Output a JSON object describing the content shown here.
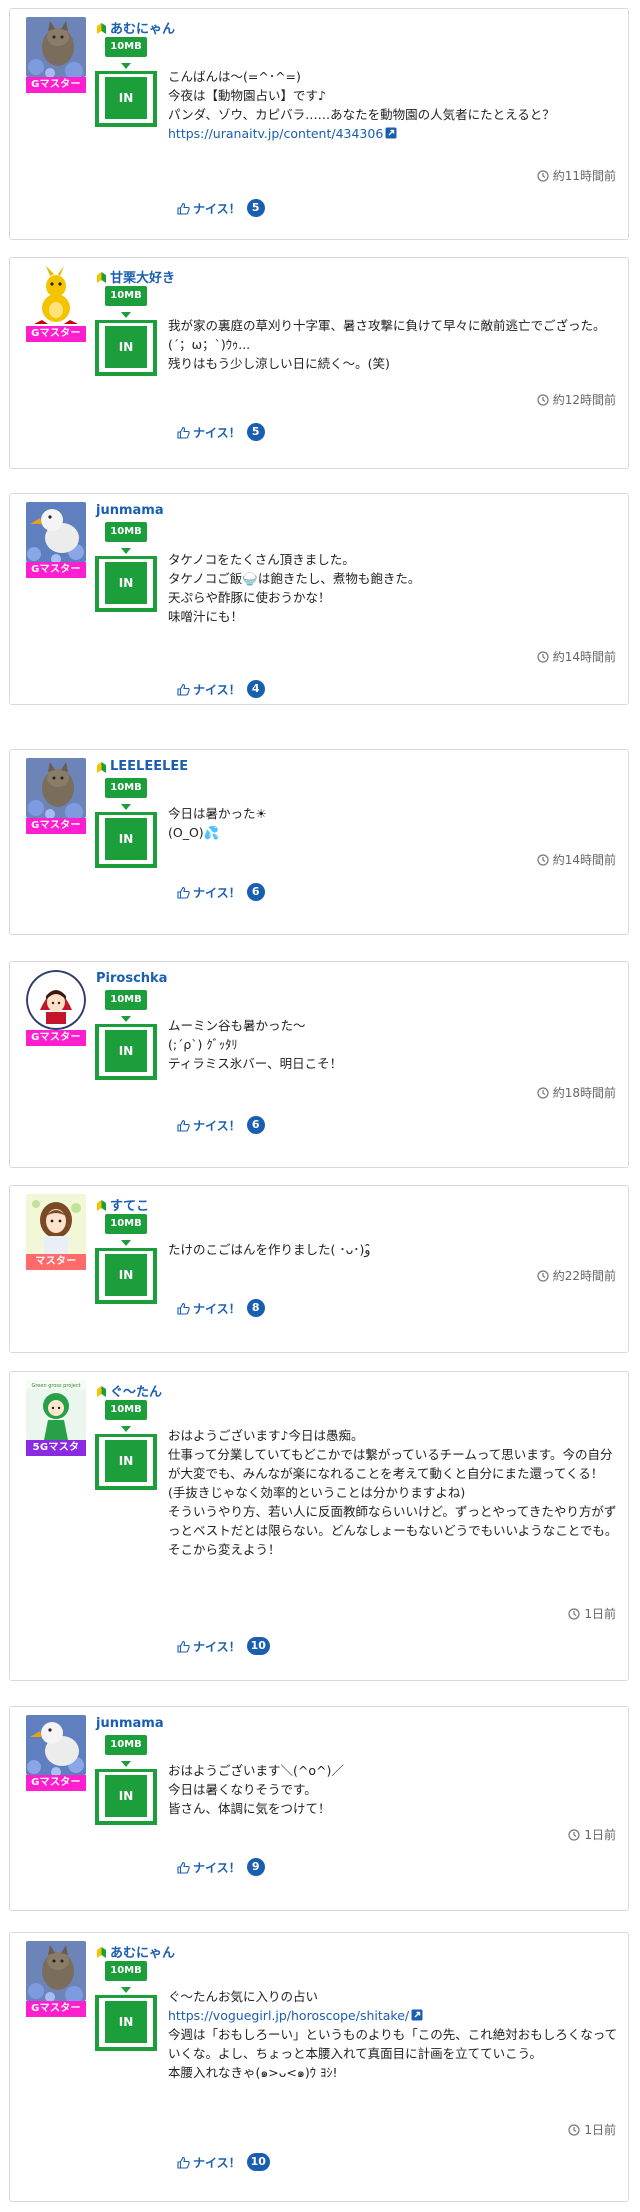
{
  "colors": {
    "link": "#1a5eb0",
    "badge_green": "#1c9e3b",
    "rank_gmaster": "#ff1fcf",
    "rank_master": "#ff6b6b",
    "rank_5gmaster": "#8a2be2"
  },
  "posts": [
    {
      "username": "あむにゃん",
      "beginner": true,
      "rank": "Gマスター",
      "rank_color": "#ff1fcf",
      "avatar": "cat-photo",
      "size_badge": "10MB",
      "in_label": "IN",
      "lines": [
        "こんばんは〜(=^･^=)",
        "今夜は【動物園占い】です♪",
        "パンダ、ゾウ、カピバラ……あなたを動物園の人気者にたとえると？"
      ],
      "link": "https://uranaitv.jp/content/434306",
      "lines_after": [],
      "time": "約11時間前",
      "nice_label": "ナイス！",
      "nice_count": "5"
    },
    {
      "username": "甘栗大好き",
      "beginner": true,
      "rank": "Gマスター",
      "rank_color": "#ff1fcf",
      "avatar": "kangaroo-illustration",
      "size_badge": "10MB",
      "in_label": "IN",
      "lines": [
        "我が家の裏庭の草刈り十字軍、暑さ攻撃に負けて早々に敵前逃亡でござった。(´；ω；`)ｳｩ...",
        "残りはもう少し涼しい日に続く〜。(笑)"
      ],
      "link": "",
      "lines_after": [],
      "time": "約12時間前",
      "nice_label": "ナイス！",
      "nice_count": "5"
    },
    {
      "username": "junmama",
      "beginner": false,
      "rank": "Gマスター",
      "rank_color": "#ff1fcf",
      "avatar": "bird-photo",
      "size_badge": "10MB",
      "in_label": "IN",
      "lines": [
        "タケノコをたくさん頂きました。",
        "タケノコご飯🍚は飽きたし、煮物も飽きた。",
        "天ぷらや酢豚に使おうかな！",
        "味噌汁にも！"
      ],
      "link": "",
      "lines_after": [],
      "time": "約14時間前",
      "nice_label": "ナイス！",
      "nice_count": "4"
    },
    {
      "username": "LEELEELEE",
      "beginner": true,
      "rank": "Gマスター",
      "rank_color": "#ff1fcf",
      "avatar": "cat-photo",
      "size_badge": "10MB",
      "in_label": "IN",
      "lines": [
        "今日は暑かった☀",
        "(O_O)💦"
      ],
      "link": "",
      "lines_after": [],
      "time": "約14時間前",
      "nice_label": "ナイス！",
      "nice_count": "6"
    },
    {
      "username": "Piroschka",
      "beginner": false,
      "rank": "Gマスター",
      "rank_color": "#ff1fcf",
      "avatar": "girl-illustration",
      "size_badge": "10MB",
      "in_label": "IN",
      "lines": [
        "ムーミン谷も暑かった〜",
        "(;´ρ`) ｸﾞｯﾀﾘ",
        "ティラミス氷バー、明日こそ！"
      ],
      "link": "",
      "lines_after": [],
      "time": "約18時間前",
      "nice_label": "ナイス！",
      "nice_count": "6"
    },
    {
      "username": "すてこ",
      "beginner": true,
      "rank": "マスター",
      "rank_color": "#ff6b6b",
      "avatar": "woman-illustration",
      "size_badge": "10MB",
      "in_label": "IN",
      "lines": [
        "たけのこごはんを作りました( ･ᴗ･)و ̑̑"
      ],
      "link": "",
      "lines_after": [],
      "time": "約22時間前",
      "nice_label": "ナイス！",
      "nice_count": "8"
    },
    {
      "username": "ぐ〜たん",
      "beginner": true,
      "rank": "5Gマスタ",
      "rank_color": "#8a2be2",
      "avatar": "green-character",
      "size_badge": "10MB",
      "in_label": "IN",
      "lines": [
        "おはようございます♪今日は愚痴。",
        "仕事って分業していてもどこかでは繋がっているチームって思います。今の自分が大変でも、みんなが楽になれることを考えて動くと自分にまた還ってくる！(手抜きじゃなく効率的ということは分かりますよね)",
        "そういうやり方、若い人に反面教師ならいいけど。ずっとやってきたやり方がずっとベストだとは限らない。どんなしょーもないどうでもいいようなことでも。そこから変えよう！"
      ],
      "link": "",
      "lines_after": [],
      "time": "1日前",
      "nice_label": "ナイス！",
      "nice_count": "10"
    },
    {
      "username": "junmama",
      "beginner": false,
      "rank": "Gマスター",
      "rank_color": "#ff1fcf",
      "avatar": "bird-photo",
      "size_badge": "10MB",
      "in_label": "IN",
      "lines": [
        "おはようございます＼(^o^)／",
        "今日は暑くなりそうです。",
        "皆さん、体調に気をつけて！"
      ],
      "link": "",
      "lines_after": [],
      "time": "1日前",
      "nice_label": "ナイス！",
      "nice_count": "9"
    },
    {
      "username": "あむにゃん",
      "beginner": true,
      "rank": "Gマスター",
      "rank_color": "#ff1fcf",
      "avatar": "cat-photo",
      "size_badge": "10MB",
      "in_label": "IN",
      "lines": [
        "ぐ〜たんお気に入りの占い"
      ],
      "link": "https://voguegirl.jp/horoscope/shitake/",
      "lines_after": [
        "今週は「おもしろーい」というものよりも「この先、これ絶対おもしろくなっていくな。よし、ちょっと本腰入れて真面目に計画を立てていこう。",
        "本腰入れなきゃ(๑>ᴗ<๑)ｳ ﾖｼ!"
      ],
      "time": "1日前",
      "nice_label": "ナイス！",
      "nice_count": "10"
    }
  ]
}
